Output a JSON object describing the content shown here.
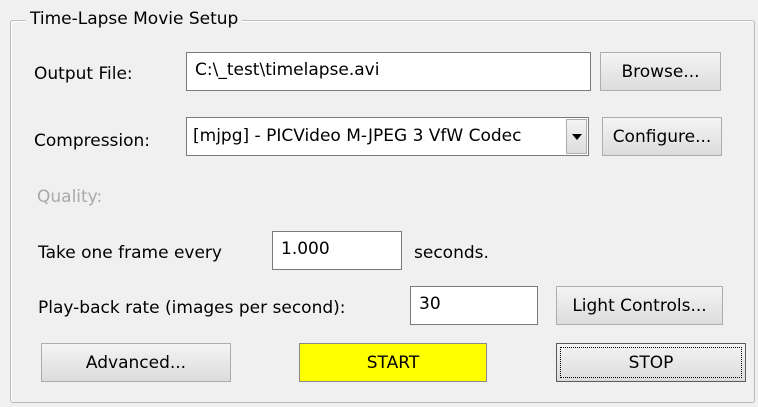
{
  "group": {
    "title": "Time-Lapse Movie Setup"
  },
  "output_file": {
    "label": "Output File:",
    "value": "C:\\_test\\timelapse.avi",
    "browse_label": "Browse..."
  },
  "compression": {
    "label": "Compression:",
    "selected": "[mjpg] - PICVideo M-JPEG 3 VfW Codec",
    "configure_label": "Configure..."
  },
  "quality": {
    "label": "Quality:"
  },
  "frame_interval": {
    "prefix": "Take one frame every",
    "value": "1.000",
    "suffix": "seconds."
  },
  "playback": {
    "label": "Play-back rate (images per second):",
    "value": "30",
    "light_controls_label": "Light Controls..."
  },
  "actions": {
    "advanced_label": "Advanced...",
    "start_label": "START",
    "stop_label": "STOP"
  },
  "colors": {
    "start_button": "#ffff00",
    "background": "#f0f0f0"
  }
}
